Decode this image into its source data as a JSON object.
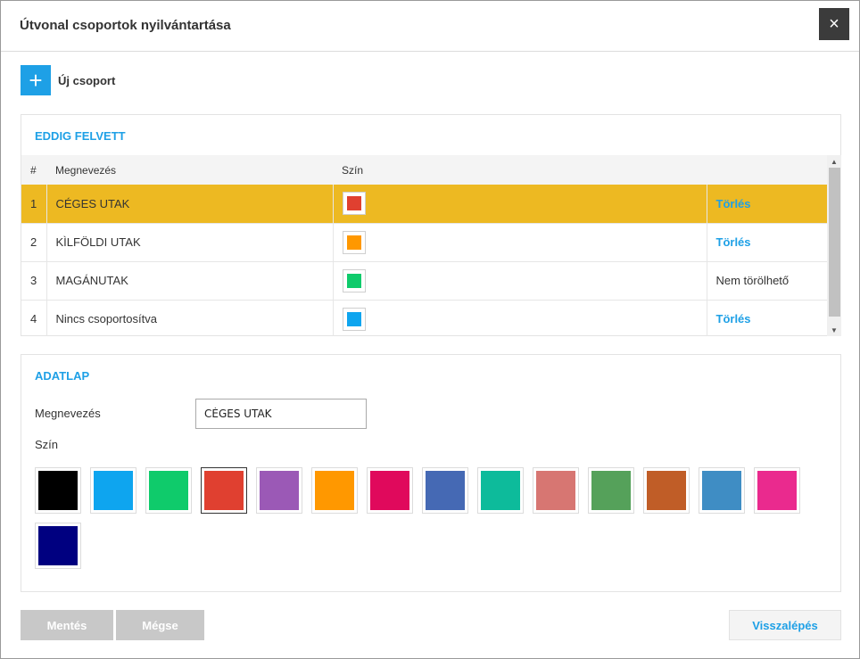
{
  "dialog": {
    "title": "Útvonal csoportok nyilvántartása",
    "close_icon": "×"
  },
  "toolbar": {
    "new_group_icon": "+",
    "new_group_label": "Új csoport"
  },
  "list_panel": {
    "heading": "EDDIG FELVETT",
    "columns": [
      "#",
      "Megnevezés",
      "Szín",
      ""
    ],
    "rows": [
      {
        "num": "1",
        "name": "CÉGES UTAK",
        "color": "#e04030",
        "action": "Törlés",
        "deletable": true,
        "selected": true
      },
      {
        "num": "2",
        "name": "KÌLFÖLDI UTAK",
        "color": "#ff9800",
        "action": "Törlés",
        "deletable": true,
        "selected": false
      },
      {
        "num": "3",
        "name": "MAGÁNUTAK",
        "color": "#0fcb6b",
        "action": "Nem törölhető",
        "deletable": false,
        "selected": false
      },
      {
        "num": "4",
        "name": "Nincs csoportosítva",
        "color": "#0ea5ef",
        "action": "Törlés",
        "deletable": true,
        "selected": false
      }
    ],
    "scroll_up_icon": "▲",
    "scroll_down_icon": "▼"
  },
  "form_panel": {
    "heading": "ADATLAP",
    "name_label": "Megnevezés",
    "name_value": "CÉGES UTAK",
    "color_label": "Szín",
    "selected_color": "#e04030",
    "palette": [
      "#000000",
      "#0ea5ef",
      "#0fcb6b",
      "#e04030",
      "#9b59b6",
      "#ff9800",
      "#e0095c",
      "#4569b4",
      "#0dbb9b",
      "#d77672",
      "#55a15a",
      "#c05d27",
      "#3f8dc4",
      "#ea2a8e",
      "#000080"
    ]
  },
  "footer": {
    "save_label": "Mentés",
    "cancel_label": "Mégse",
    "back_label": "Visszalépés"
  },
  "colors": {
    "accent": "#1ea0e6",
    "selected_row": "#edb922",
    "disabled_button": "#c8c8c8"
  }
}
